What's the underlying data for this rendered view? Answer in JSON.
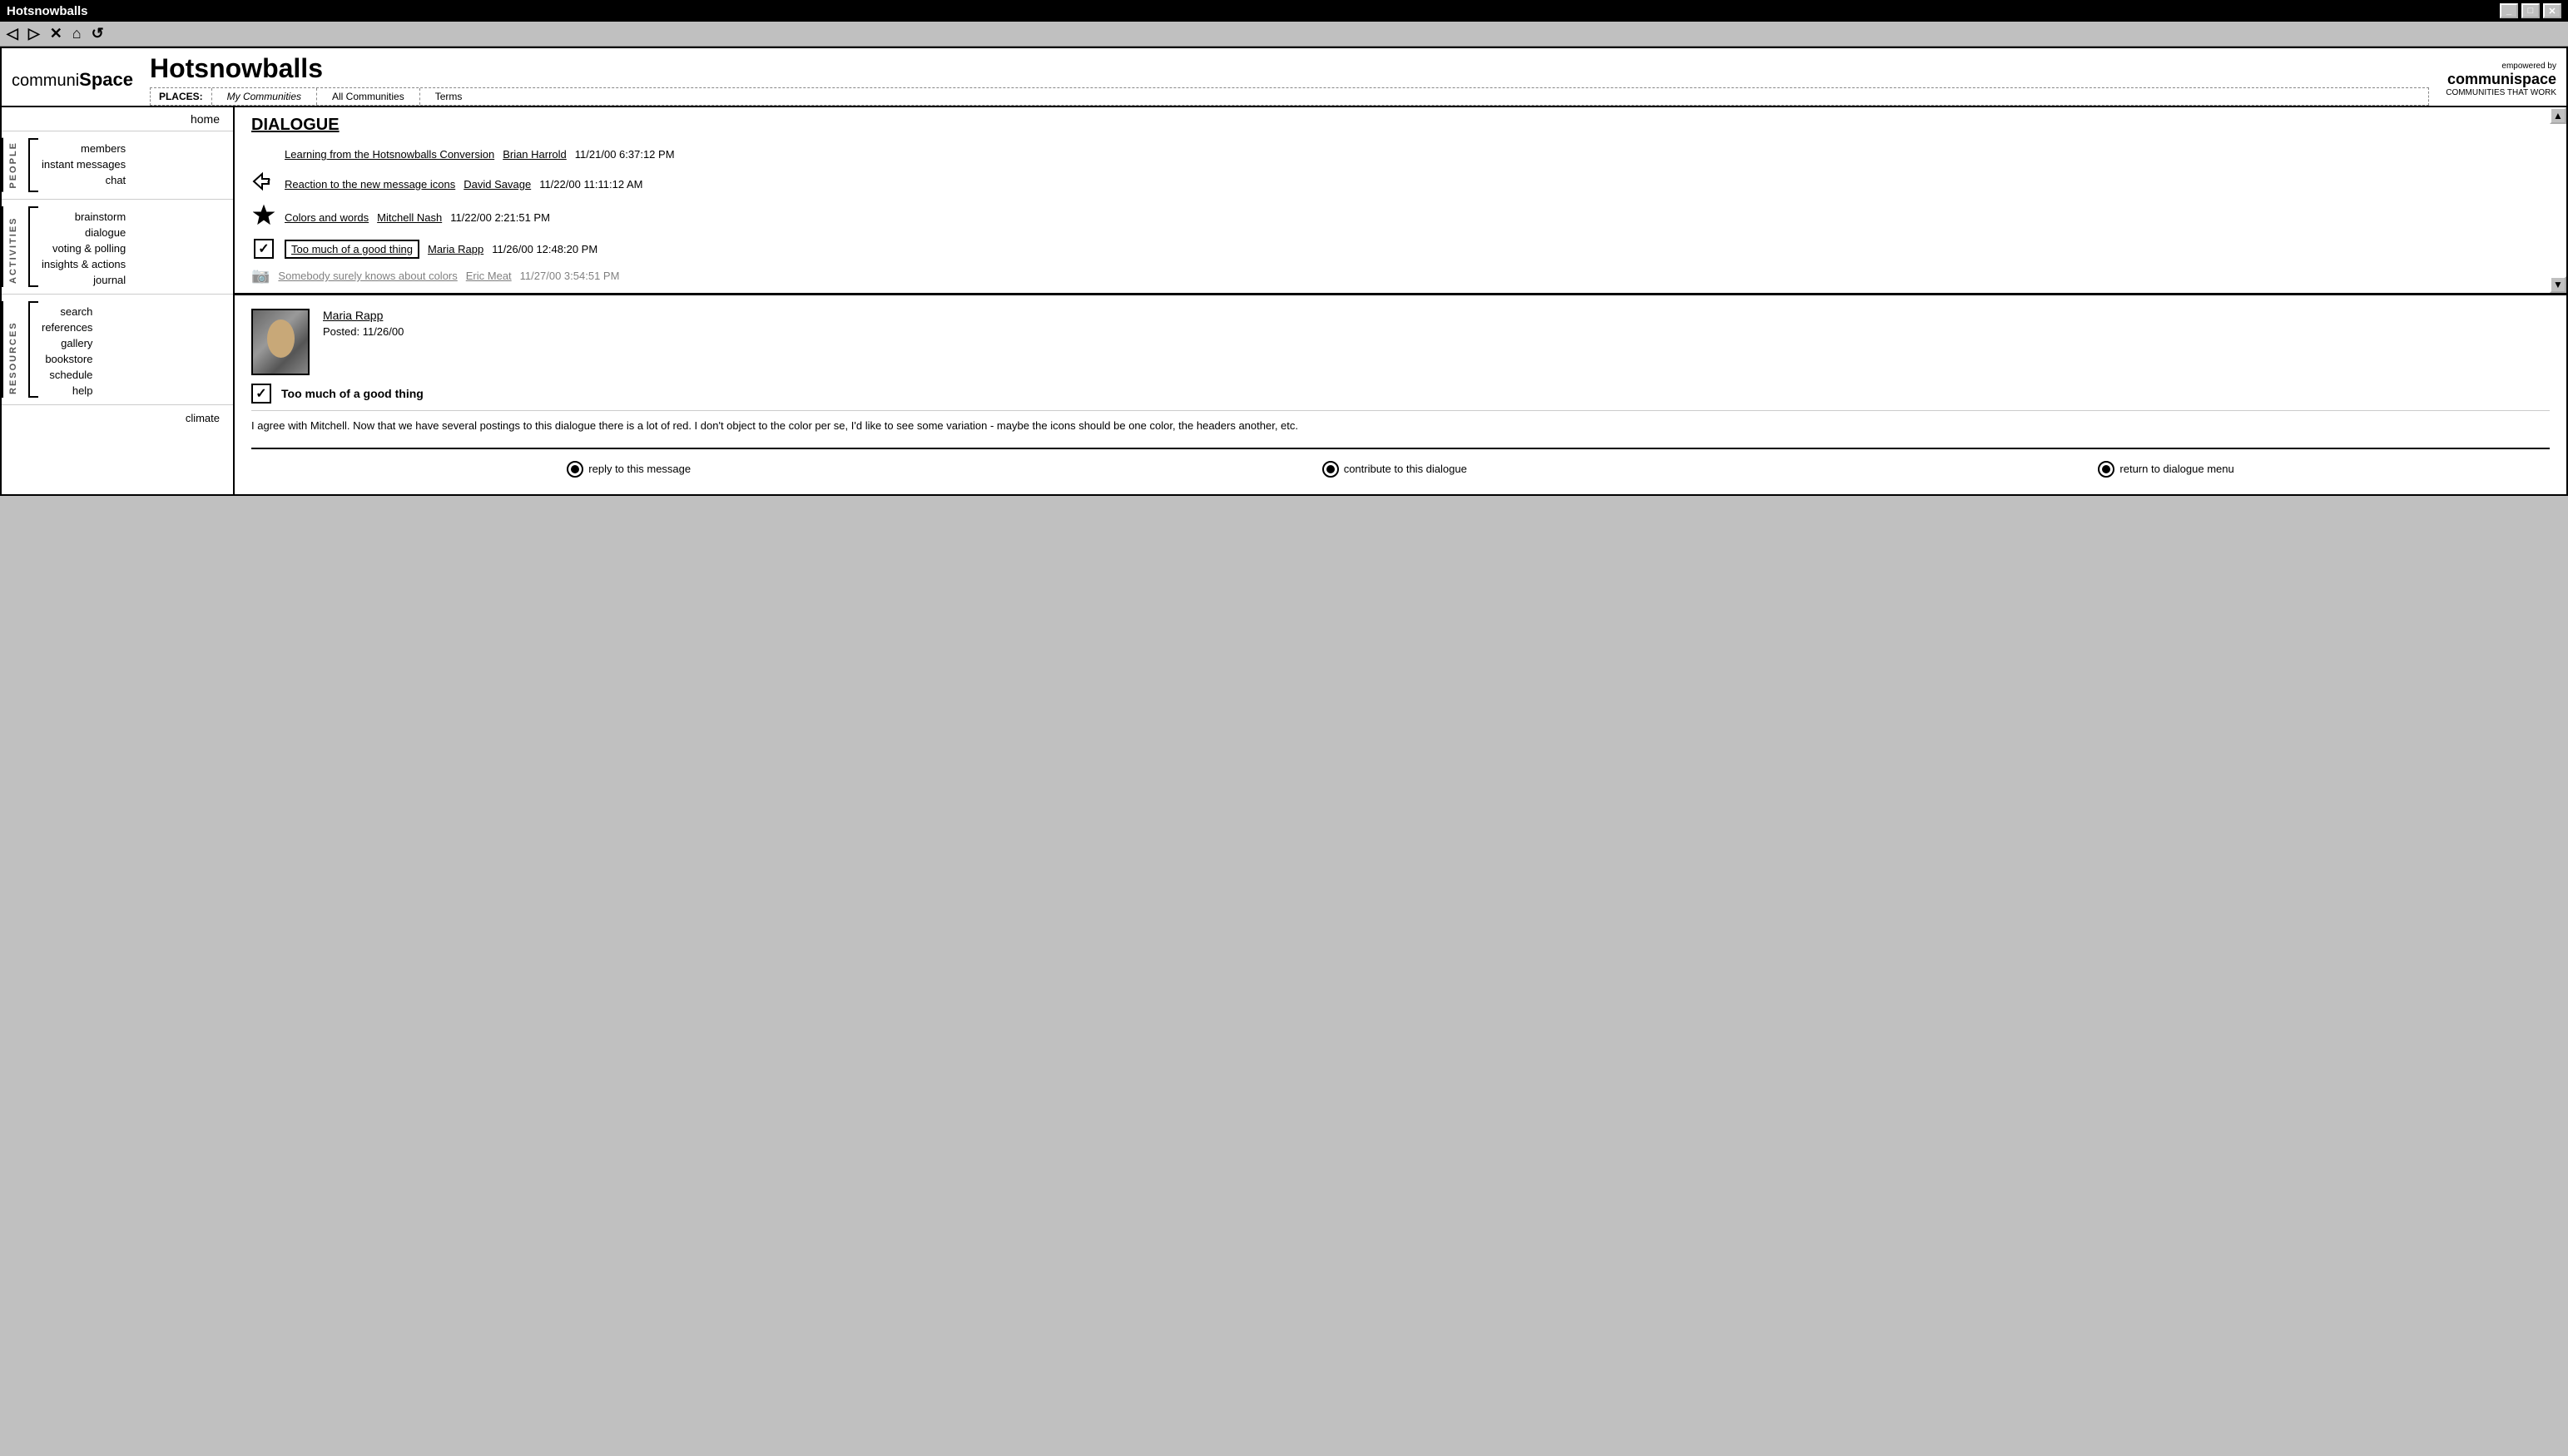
{
  "window": {
    "title": "Hotsnowballs",
    "controls": [
      "minimize",
      "maximize",
      "close"
    ]
  },
  "toolbar": {
    "back_label": "◁",
    "forward_label": "▷",
    "stop_label": "✕",
    "home_label": "⌂",
    "refresh_label": "↺"
  },
  "header": {
    "logo_left": "communiSpace",
    "site_title": "Hotsnowballs",
    "nav": {
      "places_label": "PLACES:",
      "tabs": [
        {
          "label": "My Communities",
          "italic": true
        },
        {
          "label": "All Communities",
          "italic": false
        },
        {
          "label": "Terms",
          "italic": false
        }
      ]
    },
    "logo_right": {
      "empowered": "empowered by",
      "brand": "communispace",
      "tagline": "COMMUNITIES THAT WORK"
    }
  },
  "sidebar": {
    "home_label": "home",
    "sections": [
      {
        "label": "PEOPLE",
        "items": [
          "members",
          "instant messages",
          "chat"
        ]
      },
      {
        "label": "ACTIVITIES",
        "items": [
          "brainstorm",
          "dialogue",
          "voting & polling",
          "insights & actions",
          "journal"
        ]
      },
      {
        "label": "RESOURCES",
        "items": [
          "search",
          "references",
          "gallery",
          "bookstore",
          "schedule",
          "help"
        ]
      }
    ],
    "climate_label": "climate"
  },
  "dialogue": {
    "title": "DIALOGUE",
    "items": [
      {
        "icon": "none",
        "title": "Learning from the Hotsnowballs Conversion",
        "author": "Brian Harrold",
        "date": "11/21/00 6:37:12 PM"
      },
      {
        "icon": "question-arrow",
        "title": "Reaction to the new message icons",
        "author": "David Savage",
        "date": "11/22/00 11:11:12 AM"
      },
      {
        "icon": "star",
        "title": "Colors and words",
        "author": "Mitchell Nash",
        "date": "11/22/00 2:21:51 PM"
      },
      {
        "icon": "checkbox",
        "title": "Too much of a good thing",
        "author": "Maria Rapp",
        "date": "11/26/00 12:48:20 PM"
      },
      {
        "icon": "camera",
        "title": "Somebody surely knows about colors",
        "author": "Eric Meat",
        "date": "11/27/00 3:54:51 PM",
        "blurred": true
      }
    ]
  },
  "post": {
    "author": "Maria Rapp",
    "date": "Posted: 11/26/00",
    "icon": "checkbox",
    "title": "Too much of a good thing",
    "body": "I agree with Mitchell. Now that we have several postings to this dialogue there is a lot of red.  I don't object to the color per se, I'd like to see some variation - maybe the icons should be one color, the headers another, etc."
  },
  "actions": [
    {
      "label": "reply to this message"
    },
    {
      "label": "contribute to this dialogue"
    },
    {
      "label": "return to dialogue menu"
    }
  ]
}
